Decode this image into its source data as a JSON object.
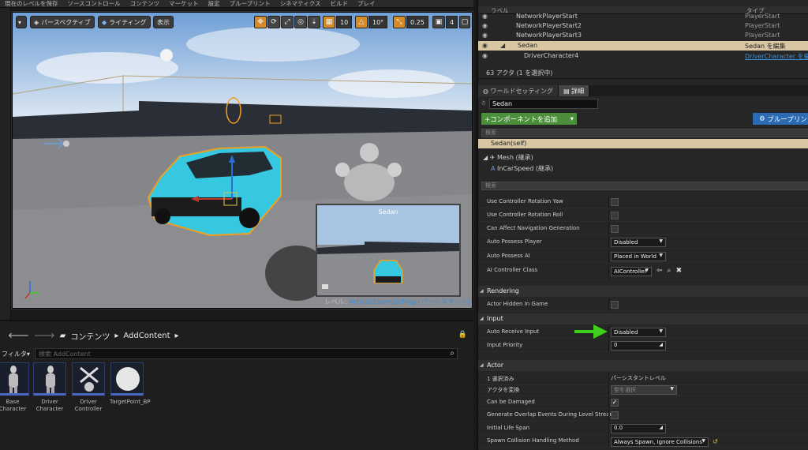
{
  "menu": [
    "現在のレベルを保存",
    "ソースコントロール",
    "コンテンツ",
    "マーケット",
    "設定",
    "ブループリント",
    "シネマティクス",
    "ビルド",
    "プレイ"
  ],
  "viewport": {
    "perspective_label": "パースペクティブ",
    "lighting_label": "ライティング",
    "show_label": "表示",
    "grid_snap": "10",
    "rotate_snap": "10°",
    "scale_snap": "0.25",
    "camera_speed": "4",
    "pip_title": "Sedan",
    "level_prefix": "レベル: ",
    "level_name": "VehicleExampleMap (パーシスタント)"
  },
  "content_browser": {
    "path_root": "コンテンツ",
    "path_child": "AddContent",
    "filter_label": "フィルタ",
    "search_placeholder": "検索 AddContent",
    "assets": [
      {
        "label": "Base Character"
      },
      {
        "label": "Driver Character"
      },
      {
        "label": "Driver Controller"
      },
      {
        "label": "TargetPoint_BP"
      }
    ]
  },
  "outliner": {
    "col_label": "ラベル",
    "col_type": "タイプ",
    "rows": [
      {
        "name": "NetworkPlayerStart",
        "type": "PlayerStart"
      },
      {
        "name": "NetworkPlayerStart2",
        "type": "PlayerStart"
      },
      {
        "name": "NetworkPlayerStart3",
        "type": "PlayerStart"
      },
      {
        "name": "Sedan",
        "type": "Sedan を編集"
      },
      {
        "name": "DriverCharacter4",
        "type": "DriverCharacter を編"
      }
    ],
    "status": "63 アクタ (1 を選択中)"
  },
  "details": {
    "tab_world": "ワールドセッティング",
    "tab_details": "詳細",
    "name_value": "Sedan",
    "add_component": "+コンポーネントを追加",
    "blueprint": "ブループリン",
    "search_placeholder": "検索",
    "self_item": "Sedan(self)",
    "mesh_item": "Mesh (継承)",
    "incar_item": "InCarSpeed (継承)",
    "search2_placeholder": "検索",
    "props_pawn": [
      {
        "label": "Use Controller Rotation Yaw",
        "kind": "checkbox",
        "checked": false
      },
      {
        "label": "Use Controller Rotation Roll",
        "kind": "checkbox",
        "checked": false
      },
      {
        "label": "Can Affect Navigation Generation",
        "kind": "checkbox",
        "checked": false
      },
      {
        "label": "Auto Possess Player",
        "kind": "dropdown",
        "value": "Disabled"
      },
      {
        "label": "Auto Possess AI",
        "kind": "dropdown",
        "value": "Placed in World"
      },
      {
        "label": "AI Controller Class",
        "kind": "dropdown",
        "value": "AIController"
      }
    ],
    "section_rendering": "Rendering",
    "prop_hidden": "Actor Hidden In Game",
    "section_input": "Input",
    "prop_auto_input": "Auto Receive Input",
    "prop_auto_input_value": "Disabled",
    "prop_input_priority": "Input Priority",
    "prop_input_priority_value": "0",
    "section_actor": "Actor",
    "prop_selected": "1 選択済み",
    "prop_selected_value": "パーシスタントレベル",
    "prop_convert": "アクタを変換",
    "prop_convert_value": "型を選択",
    "prop_can_damaged": "Can be Damaged",
    "prop_overlap": "Generate Overlap Events During Level Stream",
    "prop_lifespan": "Initial Life Span",
    "prop_lifespan_value": "0.0",
    "prop_spawn": "Spawn Collision Handling Method",
    "prop_spawn_value": "Always Spawn, Ignore Collisions"
  },
  "colors": {
    "selection": "#d9c6a3",
    "add_button": "#4c8f3a",
    "blueprint_button": "#2a6bb4",
    "vehicle": "#35c8e0",
    "arrow": "#3fd01e"
  }
}
